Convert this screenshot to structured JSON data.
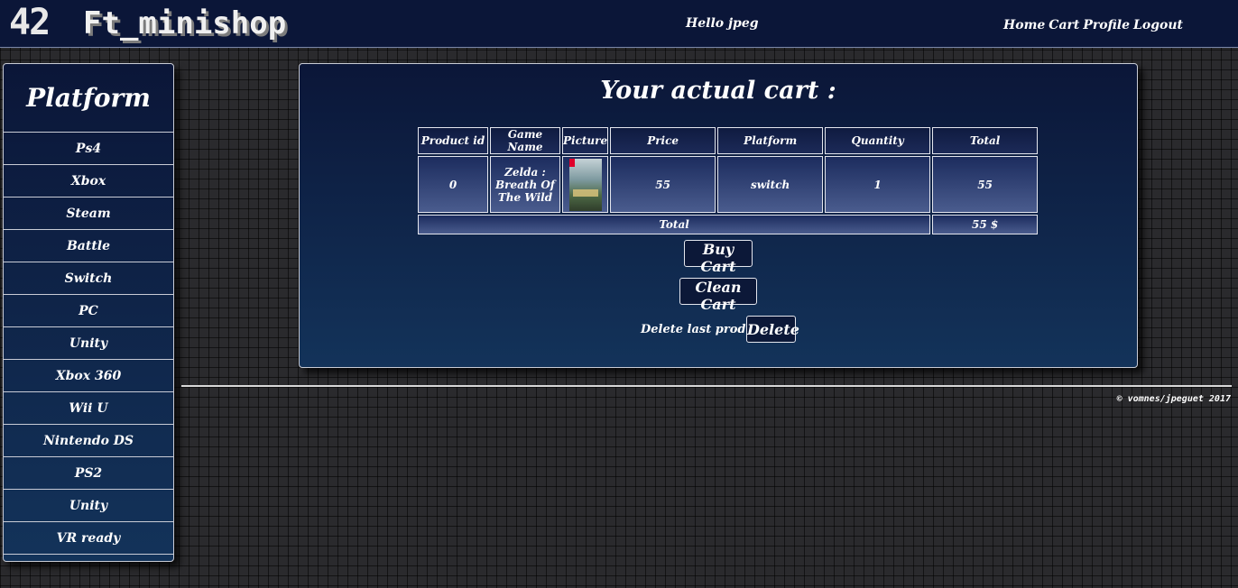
{
  "header": {
    "logo": "42",
    "brand": "Ft_minishop",
    "greeting": "Hello jpeg",
    "nav": [
      "Home",
      "Cart",
      "Profile",
      "Logout"
    ]
  },
  "sidebar": {
    "title": "Platform",
    "items": [
      "Ps4",
      "Xbox",
      "Steam",
      "Battle",
      "Switch",
      "PC",
      "Unity",
      "Xbox 360",
      "Wii U",
      "Nintendo DS",
      "PS2",
      "Unity",
      "VR ready"
    ]
  },
  "cart": {
    "title": "Your actual cart :",
    "columns": [
      "Product id",
      "Game Name",
      "Picture",
      "Price",
      "Platform",
      "Quantity",
      "Total"
    ],
    "rows": [
      {
        "product_id": "0",
        "game_name": "Zelda : Breath Of The Wild",
        "picture": "zelda-cover",
        "price": "55",
        "platform": "switch",
        "quantity": "1",
        "total": "55"
      }
    ],
    "total_label": "Total",
    "total_value": "55 $",
    "buy_label": "Buy Cart",
    "clean_label": "Clean Cart",
    "delete_text": "Delete last product",
    "delete_label": "Delete"
  },
  "footer": {
    "copyright": "© vomnes/jpeguet 2017"
  }
}
